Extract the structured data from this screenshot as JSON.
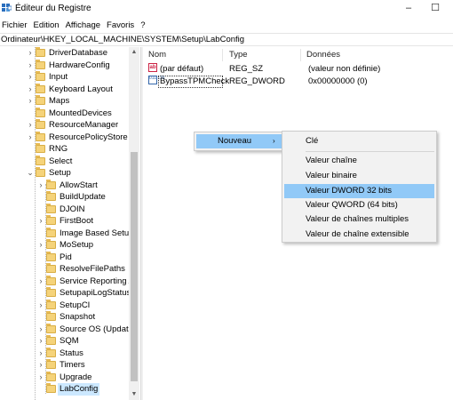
{
  "window": {
    "title": "Éditeur du Registre",
    "minimize": "–",
    "maximize": "☐"
  },
  "menu": [
    "Fichier",
    "Edition",
    "Affichage",
    "Favoris",
    "?"
  ],
  "address": "Ordinateur\\HKEY_LOCAL_MACHINE\\SYSTEM\\Setup\\LabConfig",
  "tree": {
    "items": [
      {
        "label": "DriverDatabase"
      },
      {
        "label": "HardwareConfig"
      },
      {
        "label": "Input"
      },
      {
        "label": "Keyboard Layout"
      },
      {
        "label": "Maps"
      },
      {
        "label": "MountedDevices"
      },
      {
        "label": "ResourceManager"
      },
      {
        "label": "ResourcePolicyStore"
      },
      {
        "label": "RNG"
      },
      {
        "label": "Select"
      },
      {
        "label": "Setup"
      },
      {
        "label": "AllowStart"
      },
      {
        "label": "BuildUpdate"
      },
      {
        "label": "DJOIN"
      },
      {
        "label": "FirstBoot"
      },
      {
        "label": "Image Based Setup"
      },
      {
        "label": "MoSetup"
      },
      {
        "label": "Pid"
      },
      {
        "label": "ResolveFilePaths"
      },
      {
        "label": "Service Reporting A"
      },
      {
        "label": "SetupapiLogStatus"
      },
      {
        "label": "SetupCI"
      },
      {
        "label": "Snapshot"
      },
      {
        "label": "Source OS (Update"
      },
      {
        "label": "SQM"
      },
      {
        "label": "Status"
      },
      {
        "label": "Timers"
      },
      {
        "label": "Upgrade"
      },
      {
        "label": "LabConfig"
      }
    ],
    "selected": "LabConfig"
  },
  "list": {
    "columns": [
      "Nom",
      "Type",
      "Données"
    ],
    "rows": [
      {
        "icon": "string-value-icon",
        "icon_text": "ab",
        "name": "(par défaut)",
        "type": "REG_SZ",
        "data": "(valeur non définie)"
      },
      {
        "icon": "dword-value-icon",
        "icon_text": "011 110",
        "name": "BypassTPMCheck",
        "type": "REG_DWORD",
        "data": "0x00000000 (0)"
      }
    ]
  },
  "context_menu": {
    "new_label": "Nouveau",
    "submenu": [
      "Clé",
      "Valeur chaîne",
      "Valeur binaire",
      "Valeur DWORD 32 bits",
      "Valeur QWORD (64 bits)",
      "Valeur de chaînes multiples",
      "Valeur de chaîne extensible"
    ],
    "highlighted": "Valeur DWORD 32 bits"
  },
  "colors": {
    "highlight": "#91c9f7",
    "selection": "#cce8ff",
    "folder": "#f5d37a"
  }
}
